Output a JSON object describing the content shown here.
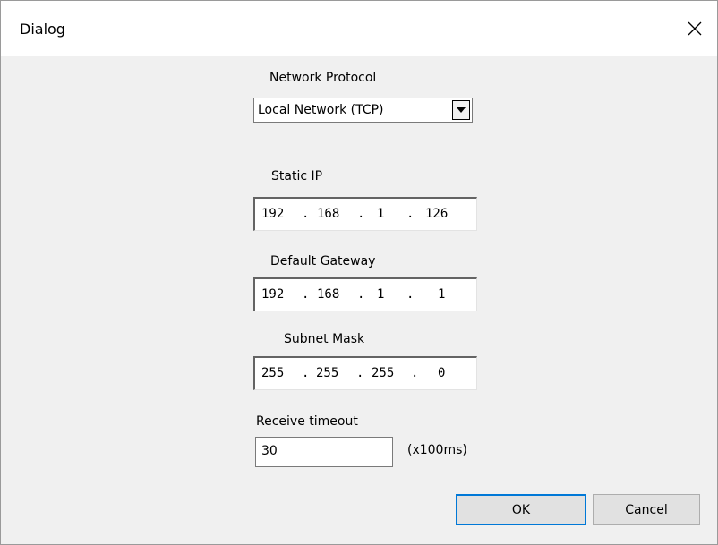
{
  "window": {
    "title": "Dialog"
  },
  "protocol": {
    "label": "Network Protocol",
    "value": "Local Network (TCP)"
  },
  "static_ip": {
    "label": "Static IP",
    "octets": [
      "192",
      "168",
      "1",
      "126"
    ]
  },
  "gateway": {
    "label": "Default Gateway",
    "octets": [
      "192",
      "168",
      "1",
      "1"
    ]
  },
  "subnet": {
    "label": "Subnet Mask",
    "octets": [
      "255",
      "255",
      "255",
      "0"
    ]
  },
  "timeout": {
    "label": "Receive timeout",
    "value": "30",
    "unit": "(x100ms)"
  },
  "buttons": {
    "ok": "OK",
    "cancel": "Cancel"
  },
  "ip_separator": ".",
  "icons": {
    "close": "close-icon",
    "dropdown": "chevron-down-icon"
  }
}
